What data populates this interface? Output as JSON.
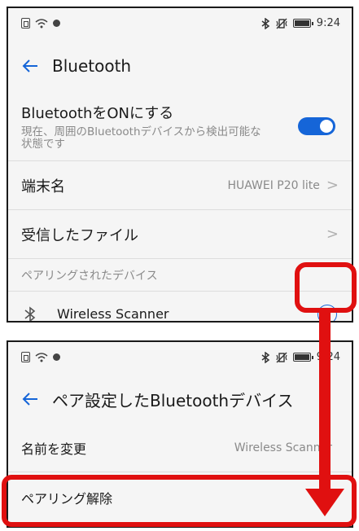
{
  "screen1": {
    "status": {
      "time": "9:24"
    },
    "header": {
      "title": "Bluetooth"
    },
    "bluetooth": {
      "title": "BluetoothをONにする",
      "subtitle": "現在、周囲のBluetoothデバイスから検出可能な状態です",
      "enabled": true
    },
    "device_name": {
      "label": "端末名",
      "value": "HUAWEI P20 lite"
    },
    "received_files": {
      "label": "受信したファイル"
    },
    "paired_section": {
      "header": "ペアリングされたデバイス"
    },
    "paired_devices": [
      {
        "name": "Wireless Scanner"
      }
    ]
  },
  "screen2": {
    "status": {
      "time": "9:24"
    },
    "header": {
      "title": "ペア設定したBluetoothデバイス"
    },
    "rename": {
      "label": "名前を変更",
      "value": "Wireless Scanner"
    },
    "unpair": {
      "label": "ペアリング解除"
    }
  },
  "colors": {
    "accent": "#1565d8",
    "annotation": "#e01010"
  }
}
